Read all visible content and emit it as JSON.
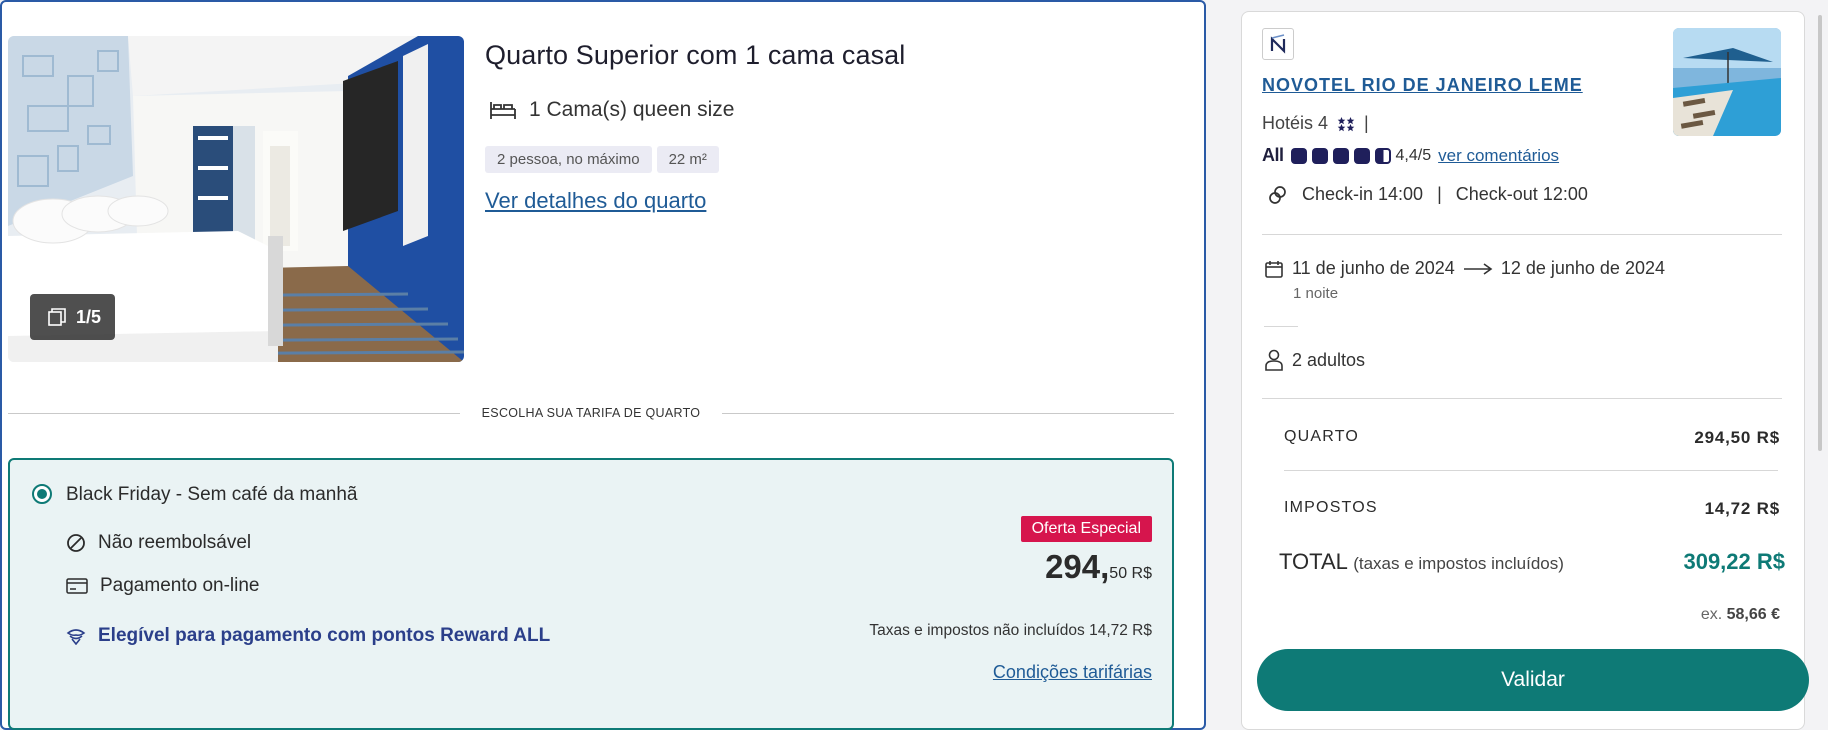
{
  "room": {
    "title": "Quarto Superior com 1 cama casal",
    "bed": "1 Cama(s) queen size",
    "chips": [
      "2 pessoa, no máximo",
      "22 m²"
    ],
    "details_link": "Ver detalhes do quarto",
    "photo_counter": "1/5"
  },
  "rate_section": {
    "divider_label": "ESCOLHA SUA TARIFA DE QUARTO"
  },
  "rate": {
    "name": "Black Friday - Sem café da manhã",
    "refund": "Não reembolsável",
    "payment": "Pagamento on-line",
    "reward": "Elegível para pagamento com pontos Reward ALL",
    "badge": "Oferta Especial",
    "price_int": "294,",
    "price_dec": "50 R$",
    "taxes_note": "Taxas e impostos não incluídos 14,72 R$",
    "conditions_link": "Condições tarifárias"
  },
  "summary": {
    "hotel_name": "NOVOTEL RIO DE JANEIRO LEME",
    "category": "Hotéis 4",
    "category_sep": "|",
    "all_label": "All",
    "rating_text": "4,4/5",
    "rating_value": 4.4,
    "reviews_link": "ver comentários",
    "checkin": "Check-in 14:00",
    "checkout_sep": "|",
    "checkout": "Check-out 12:00",
    "date_from": "11 de junho de 2024",
    "date_to": "12 de junho de 2024",
    "nights": "1 noite",
    "guests": "2 adultos",
    "room_label": "QUARTO",
    "room_value": "294,50 R$",
    "taxes_label": "IMPOSTOS",
    "taxes_value": "14,72 R$",
    "total_label": "TOTAL",
    "total_sub": "(taxas e impostos incluídos)",
    "total_value": "309,22 R$",
    "ex_label": "ex.",
    "ex_value": "58,66 €",
    "validate": "Validar"
  },
  "colors": {
    "accent": "#0e7a76",
    "link": "#1f5b96",
    "badge": "#d6154d",
    "card_border": "#2a5aa6"
  }
}
